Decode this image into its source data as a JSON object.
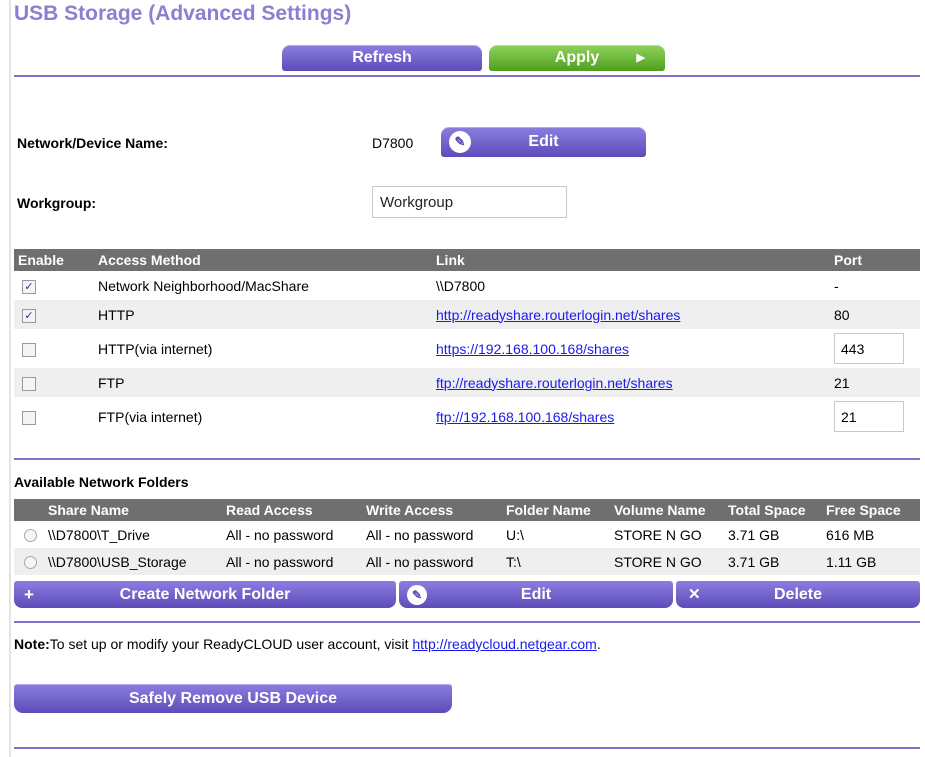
{
  "page": {
    "title": "USB Storage (Advanced Settings)"
  },
  "toolbar": {
    "refresh_label": "Refresh",
    "apply_label": "Apply"
  },
  "device": {
    "name_label": "Network/Device Name:",
    "name_value": "D7800",
    "edit_label": "Edit",
    "workgroup_label": "Workgroup:",
    "workgroup_value": "Workgroup"
  },
  "access_table": {
    "headers": [
      "Enable",
      "Access Method",
      "Link",
      "Port"
    ],
    "rows": [
      {
        "enabled": true,
        "method": "Network Neighborhood/MacShare",
        "link": "\\\\D7800",
        "port": "-"
      },
      {
        "enabled": true,
        "method": "HTTP",
        "link": "http://readyshare.routerlogin.net/shares",
        "port": "80"
      },
      {
        "enabled": false,
        "method": "HTTP(via internet)",
        "link": "https://192.168.100.168/shares",
        "port": "443"
      },
      {
        "enabled": false,
        "method": "FTP",
        "link": "ftp://readyshare.routerlogin.net/shares",
        "port": "21"
      },
      {
        "enabled": false,
        "method": "FTP(via internet)",
        "link": "ftp://192.168.100.168/shares",
        "port": "21"
      }
    ]
  },
  "folders": {
    "section_label": "Available Network Folders",
    "headers": [
      "Share Name",
      "Read Access",
      "Write Access",
      "Folder Name",
      "Volume Name",
      "Total Space",
      "Free Space"
    ],
    "rows": [
      {
        "share": "\\\\D7800\\T_Drive",
        "read": "All - no password",
        "write": "All - no password",
        "folder": "U:\\",
        "volume": "STORE N GO",
        "total": "3.71 GB",
        "free": "616 MB"
      },
      {
        "share": "\\\\D7800\\USB_Storage",
        "read": "All - no password",
        "write": "All - no password",
        "folder": "T:\\",
        "volume": "STORE N GO",
        "total": "3.71 GB",
        "free": "1.11 GB"
      }
    ],
    "create_label": "Create Network Folder",
    "edit_label": "Edit",
    "delete_label": "Delete"
  },
  "note": {
    "prefix": "Note:",
    "text": "To set up or modify your ReadyCLOUD user account, visit ",
    "link": "http://readycloud.netgear.com",
    "suffix": "."
  },
  "remove_label": "Safely Remove USB Device",
  "colors": {
    "accent": "#7f6fd0",
    "title": "#8d7ed1",
    "apply_green": "#6cb83a",
    "header_gray": "#6f6f6f"
  }
}
